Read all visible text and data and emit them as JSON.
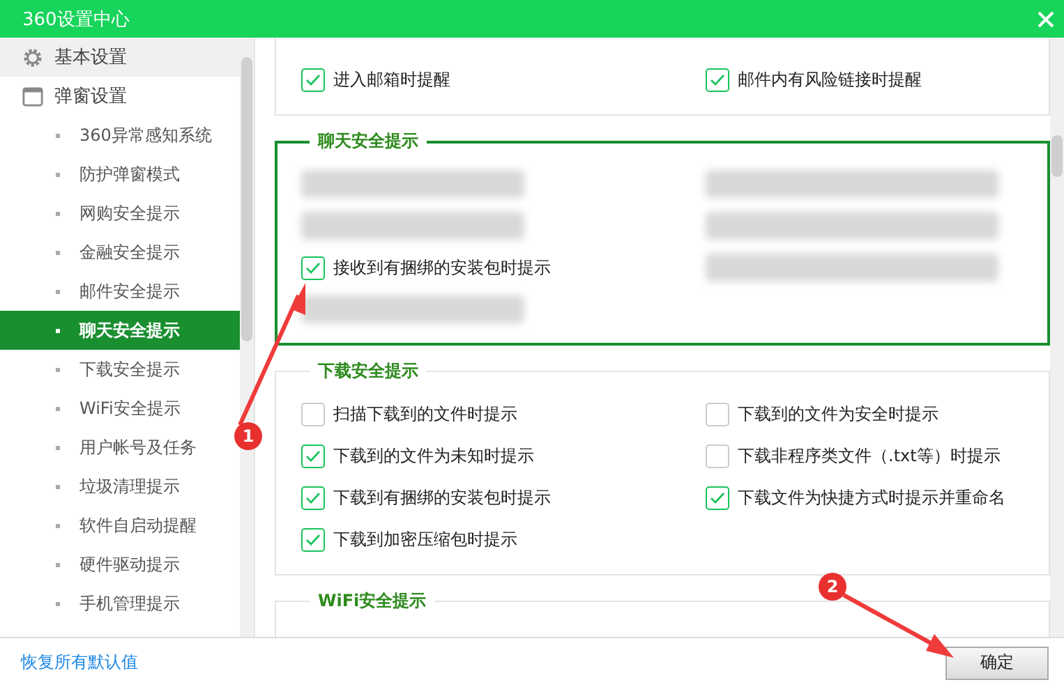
{
  "window": {
    "title": "360设置中心"
  },
  "sidebar": {
    "groups": [
      {
        "label": "基本设置",
        "expanded": false
      },
      {
        "label": "弹窗设置",
        "expanded": true,
        "children": [
          {
            "label": "360异常感知系统",
            "selected": false
          },
          {
            "label": "防护弹窗模式",
            "selected": false
          },
          {
            "label": "网购安全提示",
            "selected": false
          },
          {
            "label": "金融安全提示",
            "selected": false
          },
          {
            "label": "邮件安全提示",
            "selected": false
          },
          {
            "label": "聊天安全提示",
            "selected": true
          },
          {
            "label": "下载安全提示",
            "selected": false
          },
          {
            "label": "WiFi安全提示",
            "selected": false
          },
          {
            "label": "用户帐号及任务",
            "selected": false
          },
          {
            "label": "垃圾清理提示",
            "selected": false
          },
          {
            "label": "软件自启动提醒",
            "selected": false
          },
          {
            "label": "硬件驱动提示",
            "selected": false
          },
          {
            "label": "手机管理提示",
            "selected": false
          }
        ]
      }
    ]
  },
  "sections": [
    {
      "items": [
        {
          "kind": "checkbox",
          "label": "进入邮箱时提醒",
          "checked": true
        },
        {
          "kind": "checkbox",
          "label": "邮件内有风险链接时提醒",
          "checked": true
        }
      ]
    },
    {
      "title": "聊天安全提示",
      "selected": true,
      "items": [
        {
          "kind": "blurred"
        },
        {
          "kind": "blurred"
        },
        {
          "kind": "blurred"
        },
        {
          "kind": "blurred"
        },
        {
          "kind": "checkbox",
          "label": "接收到有捆绑的安装包时提示",
          "checked": true
        },
        {
          "kind": "blurred"
        },
        {
          "kind": "blurred"
        }
      ]
    },
    {
      "title": "下载安全提示",
      "selected": false,
      "items": [
        {
          "kind": "checkbox",
          "label": "扫描下载到的文件时提示",
          "checked": false
        },
        {
          "kind": "checkbox",
          "label": "下载到的文件为安全时提示",
          "checked": false
        },
        {
          "kind": "checkbox",
          "label": "下载到的文件为未知时提示",
          "checked": true
        },
        {
          "kind": "checkbox",
          "label": "下载非程序类文件（.txt等）时提示",
          "checked": false
        },
        {
          "kind": "checkbox",
          "label": "下载到有捆绑的安装包时提示",
          "checked": true
        },
        {
          "kind": "checkbox",
          "label": "下载文件为快捷方式时提示并重命名",
          "checked": true
        },
        {
          "kind": "checkbox",
          "label": "下载到加密压缩包时提示",
          "checked": true
        }
      ]
    },
    {
      "title": "WiFi安全提示",
      "selected": false
    }
  ],
  "footer": {
    "link": "恢复所有默认值",
    "button": "确定"
  },
  "annotations": [
    {
      "number": "1"
    },
    {
      "number": "2"
    }
  ]
}
